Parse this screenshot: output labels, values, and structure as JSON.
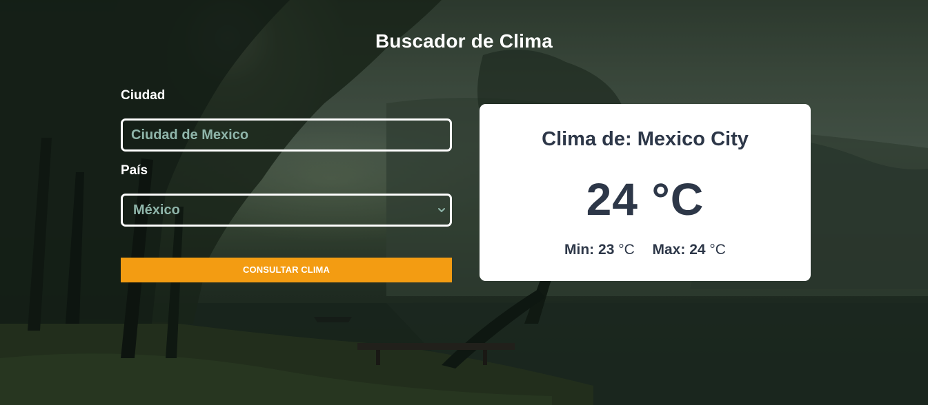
{
  "title": "Buscador de Clima",
  "form": {
    "city_label": "Ciudad",
    "city_value": "Ciudad de Mexico",
    "country_label": "País",
    "country_value": "México",
    "submit_label": "CONSULTAR CLIMA"
  },
  "result": {
    "heading": "Clima de: Mexico City",
    "temperature": "24 °C",
    "min_label": "Min:",
    "min_value": "23",
    "max_label": "Max:",
    "max_value": "24",
    "unit": "°C"
  },
  "colors": {
    "accent": "#f39c12",
    "card_text": "#2d3748",
    "input_text": "#8fb5aa"
  },
  "icons": {
    "select_arrow": "chevron-down-icon"
  }
}
